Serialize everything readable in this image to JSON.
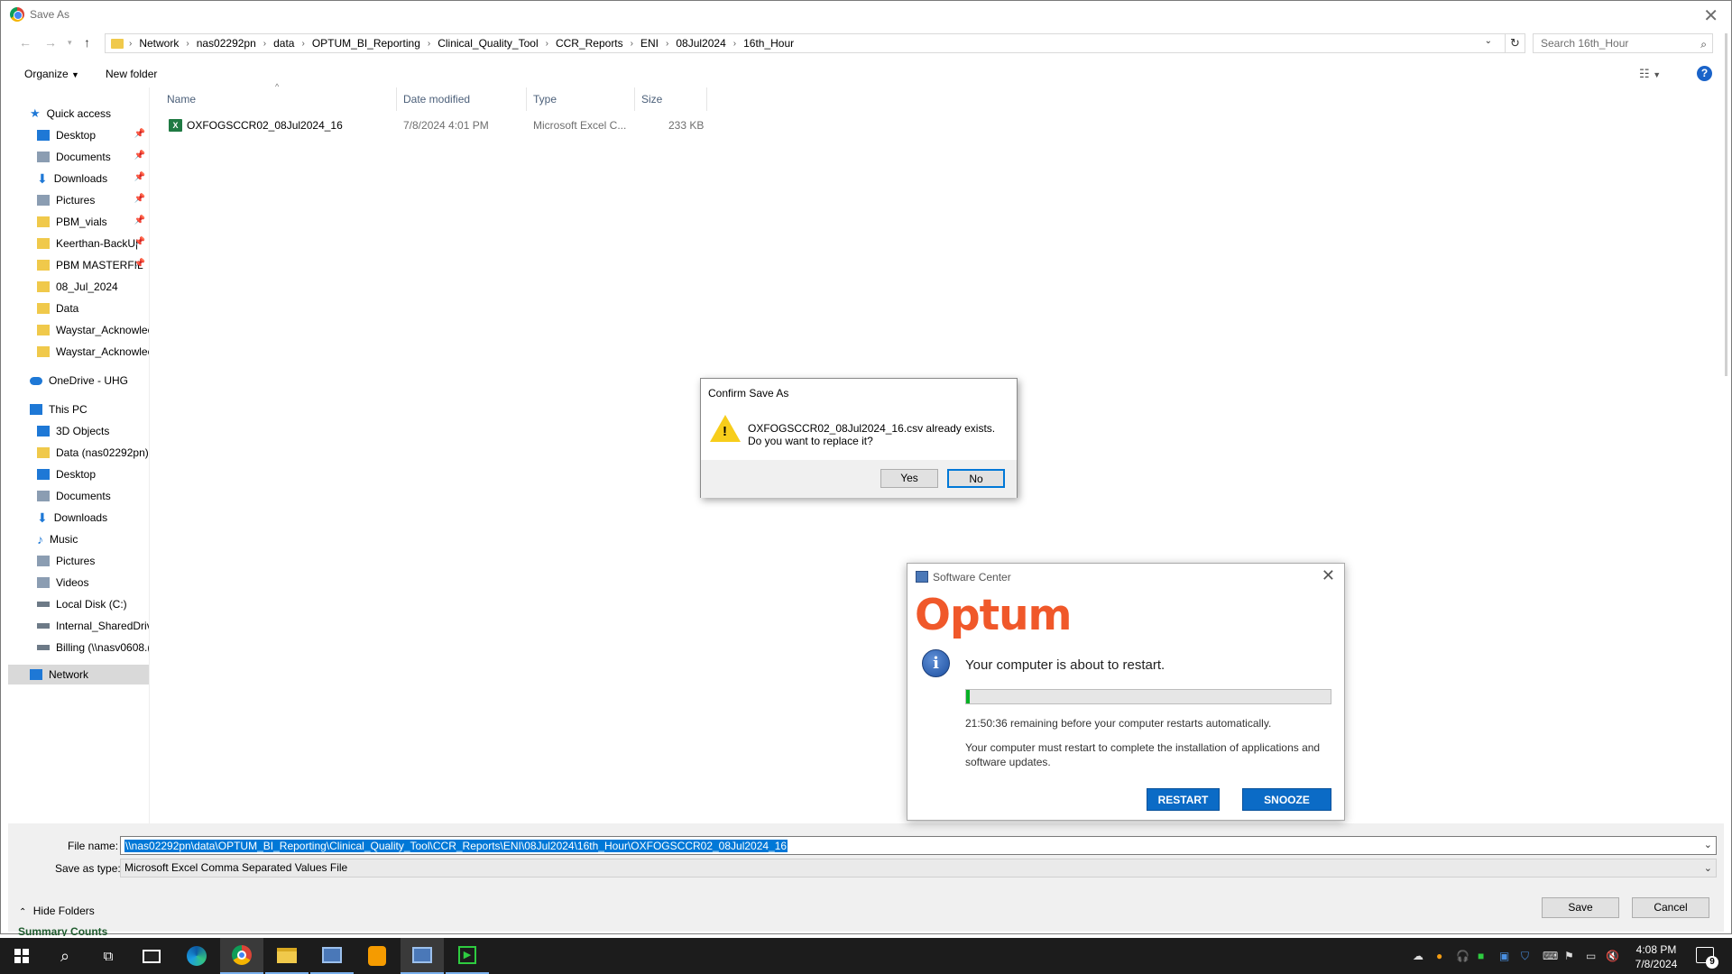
{
  "window": {
    "title": "Save As"
  },
  "address_bar": {
    "crumbs": [
      "Network",
      "nas02292pn",
      "data",
      "OPTUM_BI_Reporting",
      "Clinical_Quality_Tool",
      "CCR_Reports",
      "ENI",
      "08Jul2024",
      "16th_Hour"
    ],
    "search_placeholder": "Search 16th_Hour"
  },
  "toolbar": {
    "organize_label": "Organize",
    "new_folder_label": "New folder",
    "help_label": "?"
  },
  "nav_pane": {
    "quick_access": "Quick access",
    "quick_items": [
      "Desktop",
      "Documents",
      "Downloads",
      "Pictures",
      "PBM_vials",
      "Keerthan-BackU|",
      "PBM MASTERFIL",
      "08_Jul_2024",
      "Data",
      "Waystar_Acknowlec",
      "Waystar_Acknowlec"
    ],
    "onedrive": "OneDrive - UHG",
    "this_pc": "This PC",
    "pc_items": [
      "3D Objects",
      "Data (nas02292pn)",
      "Desktop",
      "Documents",
      "Downloads",
      "Music",
      "Pictures",
      "Videos",
      "Local Disk (C:)",
      "Internal_SharedDriv",
      "Billing (\\\\nasv0608.("
    ],
    "network": "Network"
  },
  "file_list": {
    "columns": [
      "Name",
      "Date modified",
      "Type",
      "Size"
    ],
    "rows": [
      {
        "name": "OXFOGSCCR02_08Jul2024_16",
        "date": "7/8/2024 4:01 PM",
        "type": "Microsoft Excel C...",
        "size": "233 KB"
      }
    ]
  },
  "bottom": {
    "file_name_label": "File name:",
    "file_name_value": "\\\\nas02292pn\\data\\OPTUM_BI_Reporting\\Clinical_Quality_Tool\\CCR_Reports\\ENI\\08Jul2024\\16th_Hour\\OXFOGSCCR02_08Jul2024_16",
    "save_type_label": "Save as type:",
    "save_type_value": "Microsoft Excel Comma Separated Values File",
    "hide_folders": "Hide Folders",
    "save_label": "Save",
    "cancel_label": "Cancel",
    "peek_text": "Summary Counts"
  },
  "confirm_dialog": {
    "title": "Confirm Save As",
    "message_line1": "OXFOGSCCR02_08Jul2024_16.csv already exists.",
    "message_line2": "Do you want to replace it?",
    "yes_label": "Yes",
    "no_label": "No"
  },
  "software_center": {
    "title": "Software Center",
    "brand": "Optum",
    "headline": "Your computer is about to restart.",
    "progress_fraction": 0.01,
    "remaining_text": "21:50:36 remaining before your computer restarts automatically.",
    "detail_text": "Your computer must restart to complete the installation of applications and software updates.",
    "restart_label": "RESTART",
    "snooze_label": "SNOOZE",
    "brand_color": "#f0582a",
    "button_color": "#0b6bc6"
  },
  "taskbar": {
    "time": "4:08 PM",
    "date": "7/8/2024",
    "notification_count": "9",
    "apps": [
      "start-icon",
      "search-icon",
      "task-view-icon",
      "terminal-icon",
      "edge-icon",
      "chrome-icon",
      "file-explorer-icon",
      "remote-desktop-icon",
      "app-icon",
      "software-center-icon",
      "media-icon"
    ]
  }
}
